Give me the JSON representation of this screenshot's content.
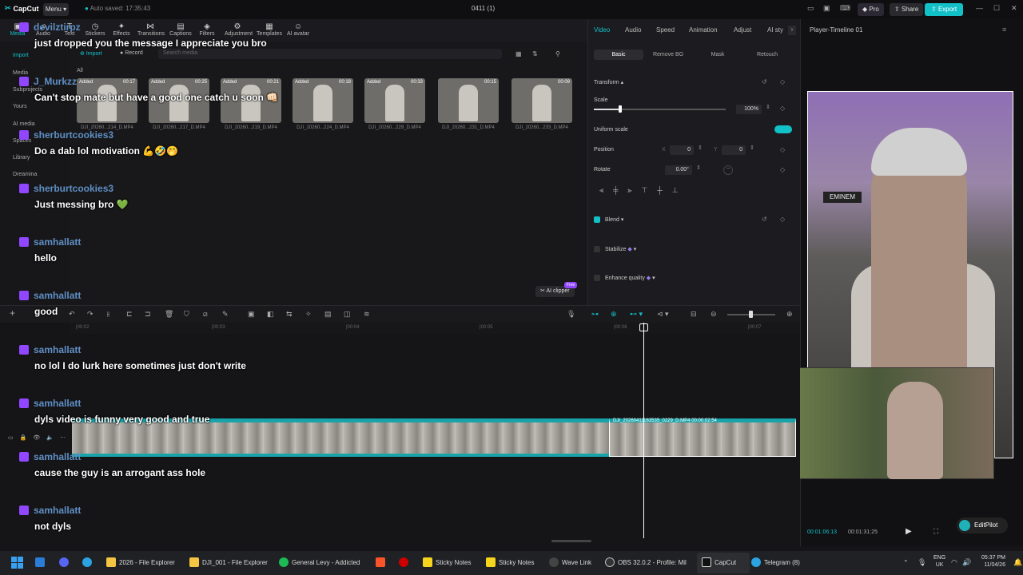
{
  "titlebar": {
    "app_name": "CapCut",
    "menu_label": "Menu",
    "autosave": "Auto saved: 17:35:43",
    "project_title": "0411 (1)",
    "pro_label": "Pro",
    "share_label": "Share",
    "export_label": "Export",
    "win_min": "—",
    "win_max": "☐",
    "win_close": "✕"
  },
  "toolbar": {
    "items": [
      {
        "label": "Media",
        "icon": "media-icon"
      },
      {
        "label": "Audio",
        "icon": "audio-icon"
      },
      {
        "label": "Text",
        "icon": "text-icon"
      },
      {
        "label": "Stickers",
        "icon": "stickers-icon"
      },
      {
        "label": "Effects",
        "icon": "effects-icon"
      },
      {
        "label": "Transitions",
        "icon": "transitions-icon"
      },
      {
        "label": "Captions",
        "icon": "captions-icon"
      },
      {
        "label": "Filters",
        "icon": "filters-icon"
      },
      {
        "label": "Adjustment",
        "icon": "adjustment-icon"
      },
      {
        "label": "Templates",
        "icon": "templates-icon"
      },
      {
        "label": "AI avatar",
        "icon": "ai-avatar-icon"
      }
    ]
  },
  "sidebar": {
    "items": [
      "Import",
      "Media",
      "Subprojects",
      "Yours",
      "AI media",
      "Spaces",
      "Library",
      "Dreamina"
    ]
  },
  "media": {
    "import_label": "Import",
    "record_label": "Record",
    "search_placeholder": "Search media",
    "all_label": "All",
    "ai_clipper": "AI clipper",
    "free_badge": "Free",
    "clips": [
      {
        "tag": "Added",
        "dur": "00:17",
        "name": "DJI_20260...214_D.MP4"
      },
      {
        "tag": "Added",
        "dur": "00:25",
        "name": "DJI_20260...217_D.MP4"
      },
      {
        "tag": "Added",
        "dur": "00:21",
        "name": "DJI_20260...219_D.MP4"
      },
      {
        "tag": "Added",
        "dur": "00:18",
        "name": "DJI_20260...224_D.MP4"
      },
      {
        "tag": "Added",
        "dur": "00:33",
        "name": "DJI_20260...229_D.MP4"
      },
      {
        "tag": "",
        "dur": "00:15",
        "name": "DJI_20260...231_D.MP4"
      },
      {
        "tag": "",
        "dur": "00:09",
        "name": "DJI_20260...233_D.MP4"
      }
    ]
  },
  "props": {
    "tabs": [
      "Video",
      "Audio",
      "Speed",
      "Animation",
      "Adjust",
      "AI sty"
    ],
    "subtabs": [
      "Basic",
      "Remove BG",
      "Mask",
      "Retouch"
    ],
    "transform": "Transform",
    "scale": "Scale",
    "scale_value": "100%",
    "scale_level": 0.2,
    "uniform_scale": "Uniform scale",
    "position": "Position",
    "pos_x_label": "X",
    "pos_x": "0",
    "pos_y_label": "Y",
    "pos_y": "0",
    "rotate": "Rotate",
    "rotate_value": "0.00°",
    "blend": "Blend",
    "stabilize": "Stabilize",
    "enhance": "Enhance quality"
  },
  "player": {
    "title": "Player-Timeline 01",
    "poster_text": "EMINEM",
    "current_time": "00:01:06:13",
    "total_time": "00:01:31:25",
    "editpilot": "EditPilot"
  },
  "timeline": {
    "ruler": [
      "|00:02",
      "|00:03",
      "|00:04",
      "|00:05",
      "|00:06",
      "|00:07"
    ],
    "clip2_label": "DJI_20260411163535_0229_D.MP4   00:00:02:54"
  },
  "chat": [
    {
      "user": "devilztirpz",
      "msg": "just dropped you the message I appreciate you bro"
    },
    {
      "user": "J_Murkzz",
      "msg": "Can't stop mate but have a good one catch u soon 👊🏻"
    },
    {
      "user": "sherburtcookies3",
      "msg": "Do a dab lol motivation 💪🤣🤭"
    },
    {
      "user": "sherburtcookies3",
      "msg": "Just messing bro 💚"
    },
    {
      "user": "samhallatt",
      "msg": "hello"
    },
    {
      "user": "samhallatt",
      "msg": "good"
    },
    {
      "user": "samhallatt",
      "msg": "no lol I do lurk here sometimes just don't write"
    },
    {
      "user": "samhallatt",
      "msg": "dyls video is funny very good and true"
    },
    {
      "user": "samhallatt",
      "msg": "cause the guy is an arrogant ass hole"
    },
    {
      "user": "samhallatt",
      "msg": "not dyls"
    }
  ],
  "taskbar": {
    "items": [
      {
        "label": "2026 - File Explorer",
        "color": "#f4c542"
      },
      {
        "label": "DJI_001 - File Explorer",
        "color": "#f4c542"
      },
      {
        "label": "General Levy - Addicted",
        "color": "#1db954"
      },
      {
        "label": "Sticky Notes",
        "color": "#f7d51d"
      },
      {
        "label": "Sticky Notes",
        "color": "#f7d51d"
      },
      {
        "label": "Wave Link",
        "color": "#444"
      },
      {
        "label": "OBS 32.0.2 - Profile: Mil",
        "color": "#333"
      },
      {
        "label": "CapCut",
        "color": "#222"
      },
      {
        "label": "Telegram (8)",
        "color": "#2aa3e0"
      }
    ],
    "lang": "ENG",
    "region": "UK",
    "time": "05:37 PM",
    "date": "11/04/26"
  },
  "colors": {
    "accent": "#12c0c8",
    "twitch": "#9146ff",
    "chat_user": "#5f8fc4"
  }
}
